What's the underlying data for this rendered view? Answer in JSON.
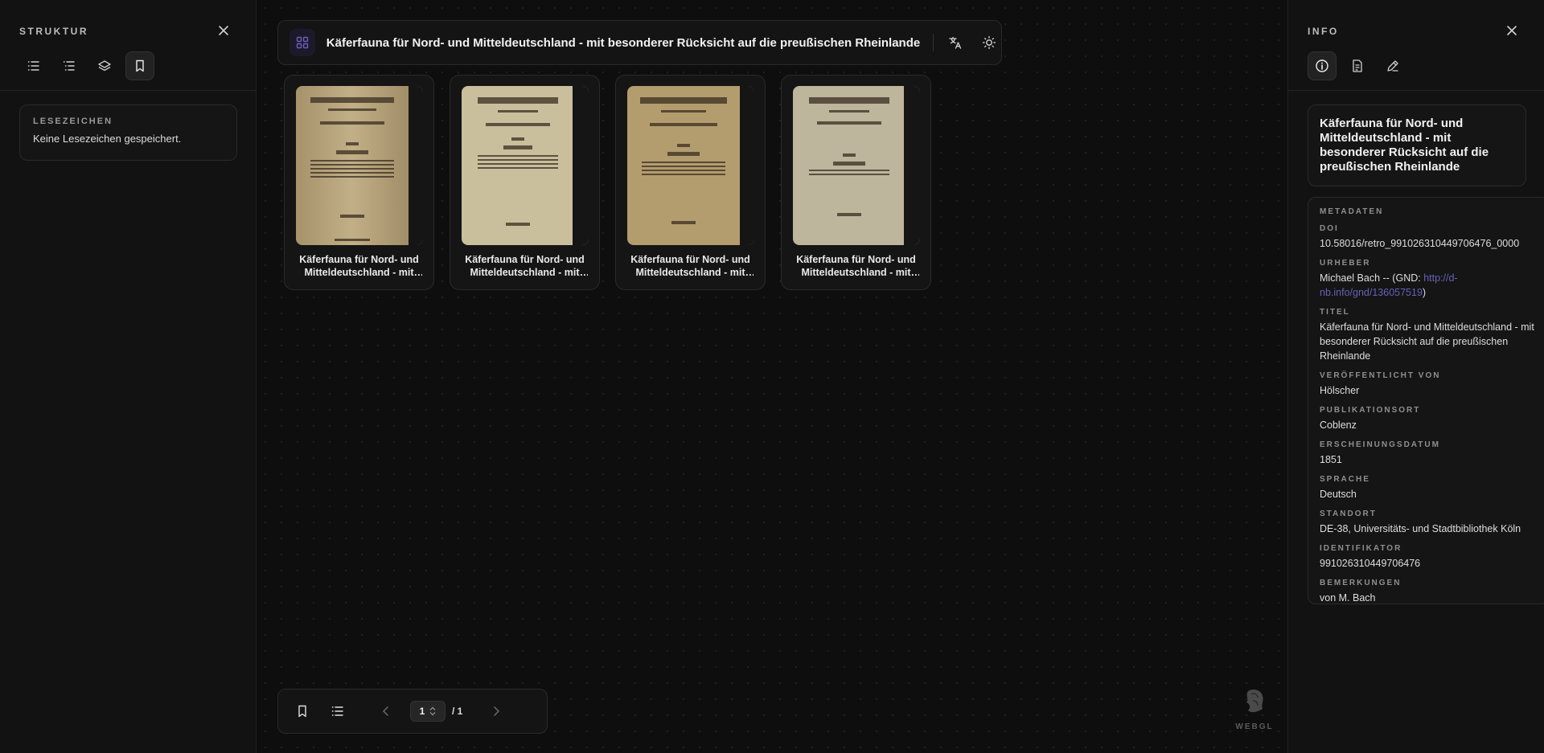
{
  "left_panel": {
    "title": "STRUKTUR",
    "bookmarks": {
      "label": "LESEZEICHEN",
      "empty_text": "Keine Lesezeichen gespeichert."
    }
  },
  "header": {
    "title": "Käferfauna für Nord- und Mitteldeutschland - mit besonderer Rücksicht auf die preußischen Rheinlande"
  },
  "thumbnails": [
    {
      "caption": "Käferfauna für Nord- und Mitteldeutschland - mit besonderer Rücksicht auf die preußischen Rheinlande"
    },
    {
      "caption": "Käferfauna für Nord- und Mitteldeutschland - mit besonderer Rücksicht auf die preußischen Rheinlande"
    },
    {
      "caption": "Käferfauna für Nord- und Mitteldeutschland - mit besonderer Rücksicht auf die preußischen Rheinlande"
    },
    {
      "caption": "Käferfauna für Nord- und Mitteldeutschland - mit besonderer Rücksicht auf die preußischen Rheinlande"
    }
  ],
  "pagination": {
    "current": "1",
    "total": "/ 1"
  },
  "webgl_label": "WEBGL",
  "right_panel": {
    "title": "INFO",
    "doc_title": "Käferfauna für Nord- und Mitteldeutschland - mit besonderer Rücksicht auf die preußischen Rheinlande",
    "metadata_label": "METADATEN",
    "fields": {
      "doi_label": "DOI",
      "doi": "10.58016/retro_991026310449706476_0000",
      "urheber_label": "URHEBER",
      "urheber_prefix": "Michael Bach -- (GND: ",
      "urheber_link": "http://d-nb.info/gnd/136057519",
      "urheber_suffix": ")",
      "titel_label": "TITEL",
      "titel": "Käferfauna für Nord- und Mitteldeutschland - mit besonderer Rücksicht auf die preußischen Rheinlande",
      "verlag_label": "VERÖFFENTLICHT VON",
      "verlag": "Hölscher",
      "ort_label": "PUBLIKATIONSORT",
      "ort": "Coblenz",
      "datum_label": "ERSCHEINUNGSDATUM",
      "datum": "1851",
      "sprache_label": "SPRACHE",
      "sprache": "Deutsch",
      "standort_label": "STANDORT",
      "standort": "DE-38, Universitäts- und Stadtbibliothek Köln",
      "identifikator_label": "IDENTIFIKATOR",
      "identifikator": "991026310449706476",
      "bemerkungen_label": "BEMERKUNGEN",
      "bemerkungen": "von M. Bach"
    }
  },
  "colors": {
    "background": "#0d0d0d",
    "panel": "#121212",
    "accent": "#6a5fb8"
  }
}
